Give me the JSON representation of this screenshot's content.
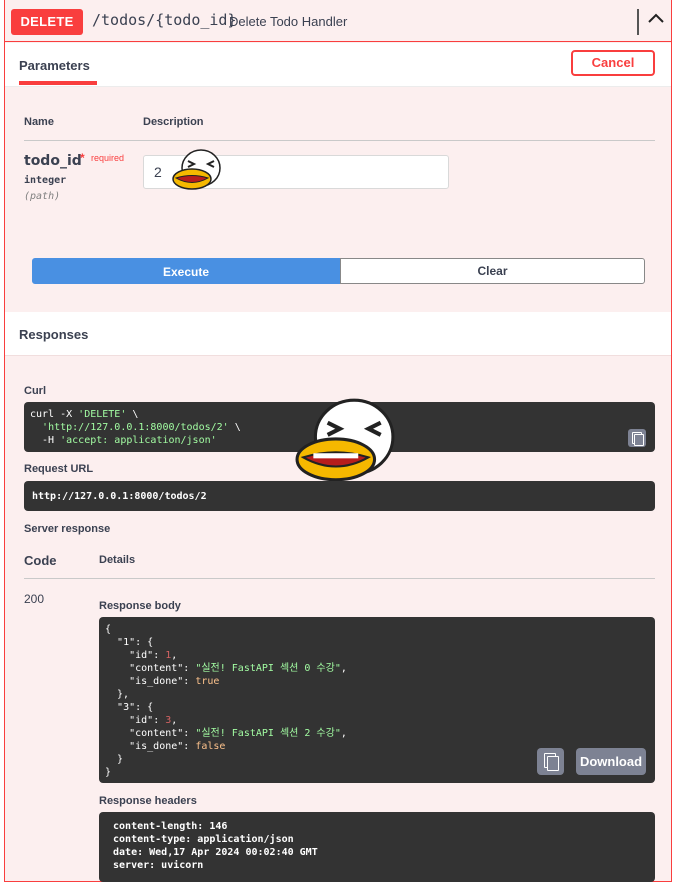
{
  "header": {
    "method": "DELETE",
    "path": "/todos/{todo_id}",
    "summary": "Delete Todo Handler"
  },
  "tabs": {
    "parameters": "Parameters",
    "cancel": "Cancel"
  },
  "params_table": {
    "col_name": "Name",
    "col_desc": "Description",
    "param": {
      "name": "todo_id",
      "required_mark": "*",
      "required_label": "required",
      "type": "integer",
      "in": "(path)",
      "value": "2"
    }
  },
  "actions": {
    "execute": "Execute",
    "clear": "Clear"
  },
  "responses": {
    "title": "Responses",
    "curl_label": "Curl",
    "curl_lines": [
      "curl -X 'DELETE' \\",
      "  'http://127.0.0.1:8000/todos/2' \\",
      "  -H 'accept: application/json'"
    ],
    "request_url_label": "Request URL",
    "request_url": "http://127.0.0.1:8000/todos/2",
    "server_response_label": "Server response",
    "code_header": "Code",
    "details_header": "Details",
    "code": "200",
    "response_body_label": "Response body",
    "download": "Download",
    "response_body": {
      "items": [
        {
          "key": "1",
          "id": "1",
          "content": "실전! FastAPI 섹션 0 수강",
          "is_done": "true"
        },
        {
          "key": "3",
          "id": "3",
          "content": "실전! FastAPI 섹션 2 수강",
          "is_done": "false"
        }
      ]
    },
    "response_headers_label": "Response headers",
    "response_headers": [
      " content-length: 146 ",
      " content-type: application/json ",
      " date: Wed,17 Apr 2024 00:02:40 GMT ",
      " server: uvicorn "
    ]
  },
  "colors": {
    "delete_red": "#f93e3e",
    "execute_blue": "#4990e2",
    "code_bg": "#333333",
    "panel_bg": "#fcefef"
  }
}
